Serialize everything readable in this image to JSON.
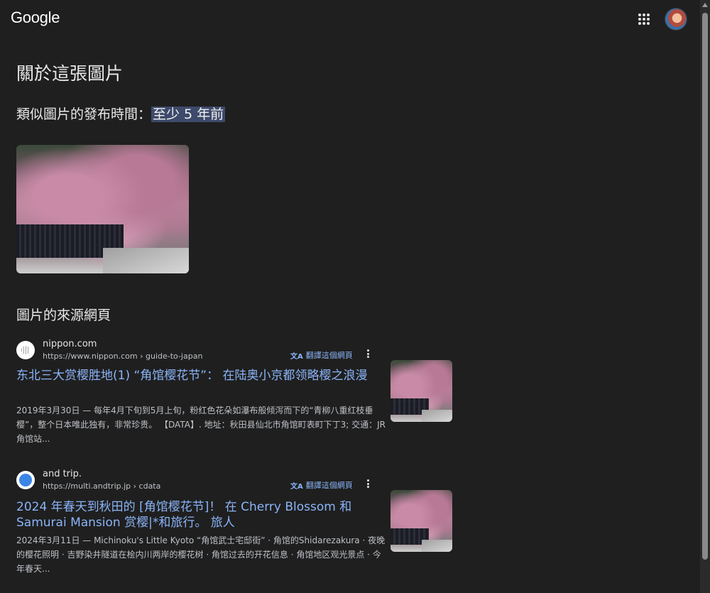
{
  "header": {
    "logo": "Google",
    "apps_icon": "apps-grid-icon",
    "avatar_icon": "user-avatar"
  },
  "about_title": "關於這張圖片",
  "date_info": {
    "label": "類似圖片的發布時間：",
    "value": "至少 5 年前"
  },
  "sources_title": "圖片的來源網頁",
  "results": [
    {
      "site_name": "nippon.com",
      "url": "https://www.nippon.com › guide-to-japan",
      "translate_label": "翻譯這個網頁",
      "title": "东北三大赏樱胜地(1) “角馆樱花节”： 在陆奥小京都领略樱之浪漫",
      "snippet": "2019年3月30日 — 每年4月下旬到5月上旬，粉红色花朵如瀑布般倾泻而下的“青柳八重红枝垂樱”，整个日本唯此独有，非常珍贵。 【DATA】. 地址：秋田县仙北市角馆町表町下丁3; 交通：JR角馆站..."
    },
    {
      "site_name": "and trip.",
      "url": "https://multi.andtrip.jp › cdata",
      "translate_label": "翻譯這個網頁",
      "title": "2024 年春天到秋田的 [角馆樱花节]！ 在 Cherry Blossom 和 Samurai Mansion 赏樱|*和旅行。 旅人",
      "snippet": "2024年3月11日 — Michinoku's Little Kyoto “角馆武士宅邸街” · 角馆的Shidarezakura · 夜晚的樱花照明 · 吉野染井隧道在桧内川两岸的樱花树 · 角馆过去的开花信息 · 角馆地区观光景点 · 今年春天..."
    }
  ],
  "colors": {
    "background": "#1f1f1f",
    "link": "#8ab4f8",
    "highlight": "#3d4a6b"
  }
}
